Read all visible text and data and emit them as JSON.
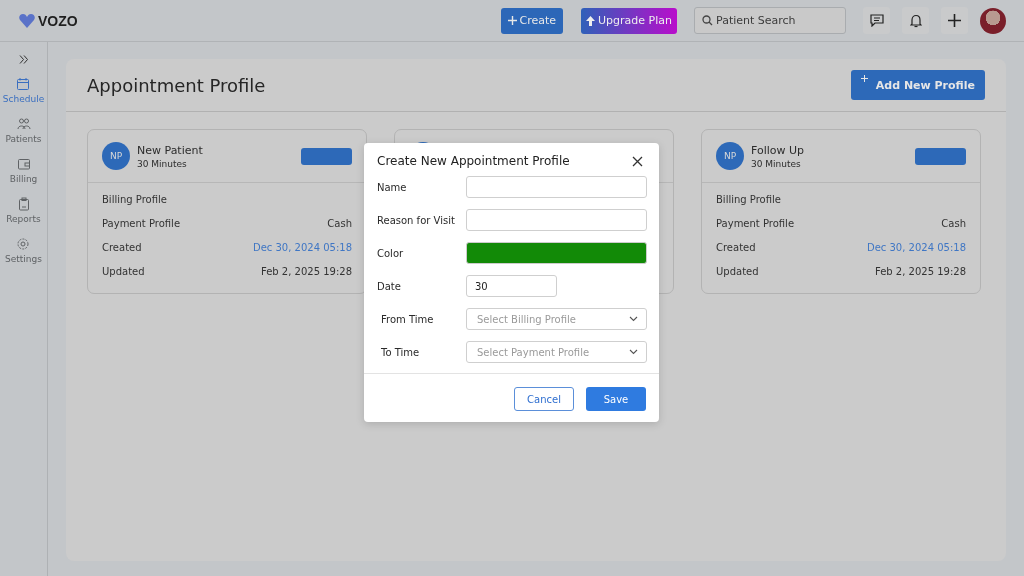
{
  "brand": {
    "name": "VOZO"
  },
  "topbar": {
    "create": "Create",
    "upgrade": "Upgrade Plan",
    "search": {
      "placeholder": "Patient Search"
    }
  },
  "sidebar": {
    "items": [
      {
        "label": "Schedule",
        "selected": true
      },
      {
        "label": "Patients",
        "selected": false
      },
      {
        "label": "Billing",
        "selected": false
      },
      {
        "label": "Reports",
        "selected": false
      },
      {
        "label": "Settings",
        "selected": false
      }
    ]
  },
  "page": {
    "title": "Appointment Profile",
    "add_button": "Add New Profile"
  },
  "cards": [
    {
      "kind": "profile",
      "initials": "NP",
      "name": "New Patient",
      "duration": "30 Minutes",
      "rows": [
        {
          "label": "Billing Profile"
        },
        {
          "label": "Payment Profile",
          "value": "Cash",
          "kind": "plain"
        },
        {
          "label": "Created",
          "value": "Dec 30, 2024 05:18",
          "kind": "link"
        },
        {
          "label": "Updated",
          "value": "Feb 2, 2025 19:28",
          "kind": "plain"
        }
      ]
    },
    {
      "kind": "covered"
    },
    {
      "kind": "profile",
      "initials": "NP",
      "name": "Follow Up",
      "duration": "30 Minutes",
      "rows": [
        {
          "label": "Billing Profile"
        },
        {
          "label": "Payment Profile",
          "value": "Cash",
          "kind": "plain"
        },
        {
          "label": "Created",
          "value": "Dec 30, 2024 05:18",
          "kind": "link"
        },
        {
          "label": "Updated",
          "value": "Feb 2, 2025 19:28",
          "kind": "plain"
        }
      ]
    }
  ],
  "modal": {
    "title": "Create New Appointment Profile",
    "fields": [
      {
        "label": "Name",
        "kind": "text"
      },
      {
        "label": "Reason for Visit",
        "kind": "text"
      },
      {
        "label": "Color",
        "kind": "color",
        "color": "#128a07"
      },
      {
        "label": "Date",
        "kind": "short",
        "value": "30"
      },
      {
        "label": "From Time",
        "kind": "select",
        "placeholder": "Select Billing Profile"
      },
      {
        "label": "To Time",
        "kind": "select",
        "placeholder": "Select Payment Profile"
      }
    ],
    "cancel": "Cancel",
    "save": "Save"
  }
}
